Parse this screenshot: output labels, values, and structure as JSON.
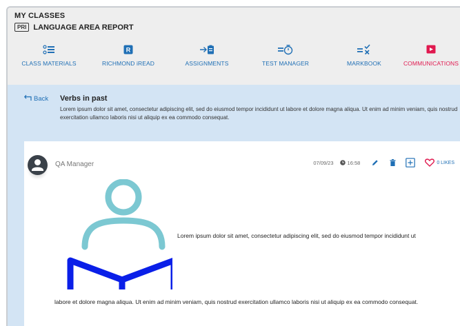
{
  "header": {
    "section_title": "MY CLASSES",
    "report_tag": "PRI",
    "report_title": "LANGUAGE AREA REPORT"
  },
  "nav": {
    "items": [
      {
        "label": "CLASS MATERIALS",
        "icon": "class-materials-icon"
      },
      {
        "label": "RICHMOND iREAD",
        "icon": "richmond-iread-icon"
      },
      {
        "label": "ASSIGNMENTS",
        "icon": "assignments-icon"
      },
      {
        "label": "TEST MANAGER",
        "icon": "test-manager-icon"
      },
      {
        "label": "MARKBOOK",
        "icon": "markbook-icon"
      },
      {
        "label": "COMMUNICATIONS",
        "icon": "communications-icon",
        "active": true
      }
    ]
  },
  "section": {
    "back_label": "Back",
    "title": "Verbs in past",
    "description": "Lorem ipsum dolor sit amet, consectetur adipiscing elit, sed do eiusmod tempor incididunt ut labore et dolore magna aliqua. Ut enim ad minim veniam, quis nostrud exercitation ullamco laboris nisi ut aliquip ex ea commodo consequat."
  },
  "post": {
    "author": "QA Manager",
    "date": "07/09/23",
    "time": "16:58",
    "likes_label": "0 LIKES",
    "text_inline": "Lorem ipsum dolor sit amet, consectetur adipiscing elit, sed do eiusmod tempor incididunt ut",
    "text_continued": "labore et dolore magna aliqua. Ut enim ad minim veniam, quis nostrud exercitation ullamco laboris nisi ut aliquip ex ea commodo consequat."
  },
  "colors": {
    "nav_blue": "#1f6fb5",
    "active_pink": "#e0194f",
    "section_bg": "#d3e4f4",
    "illustration_teal": "#7cc8d2",
    "illustration_blue": "#0a1fe8"
  }
}
